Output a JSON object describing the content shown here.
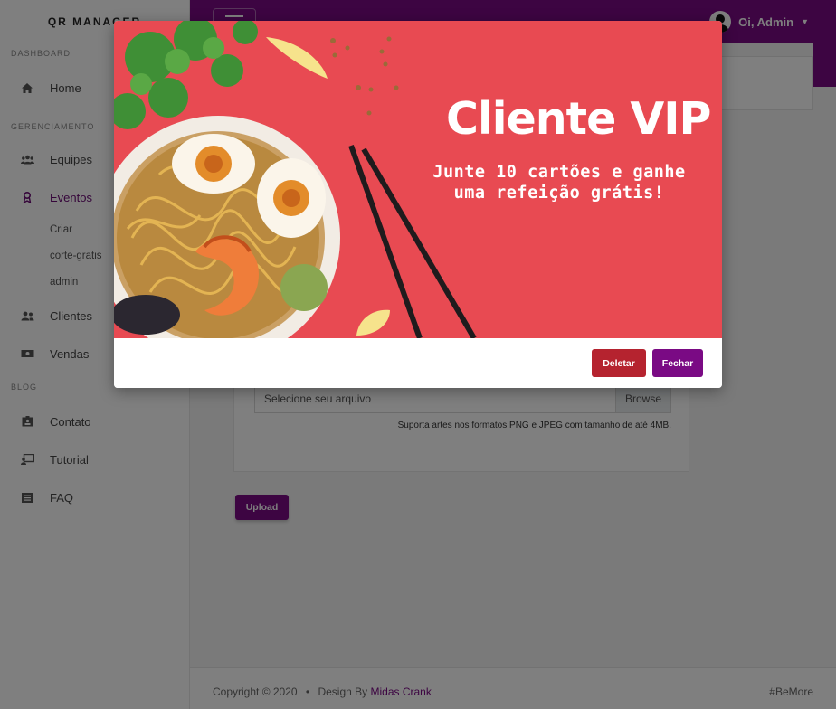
{
  "app": {
    "brand": "QR MANAGER"
  },
  "sidebar": {
    "sections": [
      {
        "label": "DASHBOARD"
      },
      {
        "label": "GERENCIAMENTO"
      },
      {
        "label": "BLOG"
      }
    ],
    "items": {
      "home": {
        "label": "Home",
        "icon": "home-icon"
      },
      "equipes": {
        "label": "Equipes",
        "icon": "users-icon"
      },
      "eventos": {
        "label": "Eventos",
        "icon": "ribbon-icon",
        "active": true
      },
      "clientes": {
        "label": "Clientes",
        "icon": "user-group-icon"
      },
      "vendas": {
        "label": "Vendas",
        "icon": "money-icon"
      },
      "contato": {
        "label": "Contato",
        "icon": "contact-card-icon"
      },
      "tutorial": {
        "label": "Tutorial",
        "icon": "presentation-icon"
      },
      "faq": {
        "label": "FAQ",
        "icon": "list-icon"
      }
    },
    "eventos_sub": [
      "Criar",
      "corte-gratis",
      "admin"
    ]
  },
  "header": {
    "user_label": "Oi, Admin",
    "accent": "#7a0a84"
  },
  "form": {
    "file_placeholder": "Selecione seu arquivo",
    "browse_label": "Browse",
    "help": "Suporta artes nos formatos PNG e JPEG com tamanho de até 4MB.",
    "upload_label": "Upload"
  },
  "footer": {
    "copyright": "Copyright © 2020",
    "design_by": "Design By",
    "author": "Midas Crank",
    "tagline": "#BeMore"
  },
  "modal": {
    "banner_title": "Cliente VIP",
    "banner_line1": "Junte 10 cartões e ganhe",
    "banner_line2": "uma refeição grátis!",
    "delete_label": "Deletar",
    "close_label": "Fechar",
    "colors": {
      "banner_bg": "#e84a52",
      "delete": "#b5232f",
      "close": "#7a0a84"
    }
  }
}
